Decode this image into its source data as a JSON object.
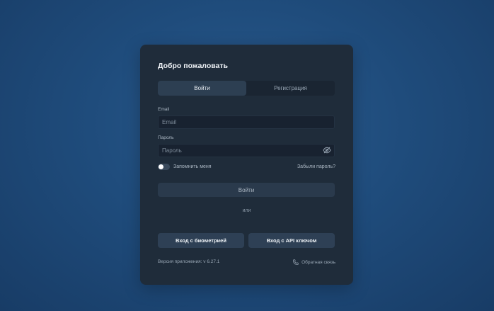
{
  "login": {
    "title": "Добро пожаловать",
    "tabs": [
      {
        "label": "Войти",
        "active": true
      },
      {
        "label": "Регистрация",
        "active": false
      }
    ],
    "email": {
      "label": "Email",
      "placeholder": "Email",
      "value": ""
    },
    "password": {
      "label": "Пароль",
      "placeholder": "Пароль",
      "value": "",
      "icon": "eye-off-icon"
    },
    "remember": {
      "label": "Запомнить меня",
      "checked": false
    },
    "forgot_label": "Забыли пароль?",
    "submit_label": "Войти",
    "divider_label": "или",
    "biometric_label": "Вход с биометрией",
    "api_key_label": "Вход с API ключом",
    "version_text": "Версия приложения: v 6.27.1",
    "feedback": {
      "label": "Обратная связь",
      "icon": "phone-icon"
    }
  },
  "colors": {
    "background": "#1f4c7c",
    "card": "#1f2c3a",
    "accent_button": "#2e4055"
  }
}
